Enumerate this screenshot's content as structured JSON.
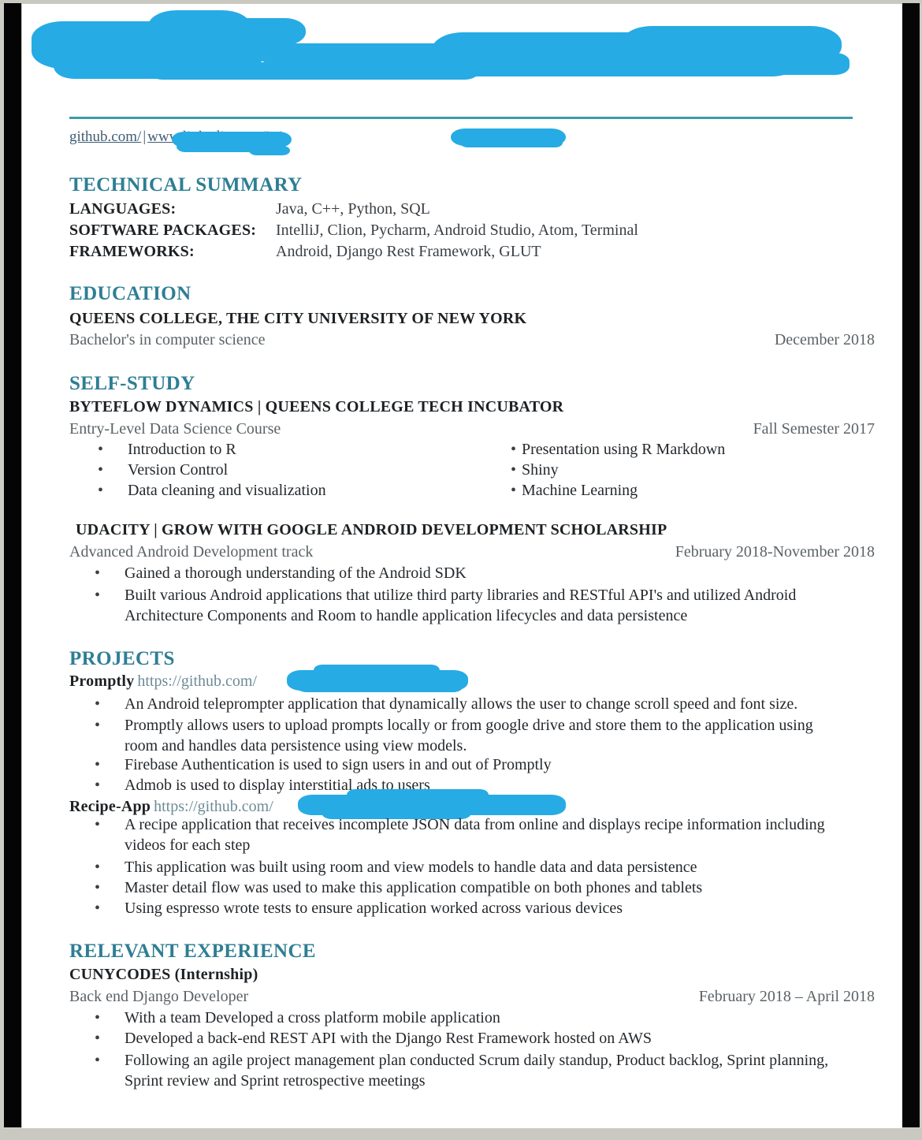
{
  "document": {
    "type": "resume",
    "header": {
      "name_redacted": true,
      "redaction_color": "#26ABE4",
      "contact_line_redacted": true
    },
    "links": {
      "github_prefix": "github.com/",
      "separator": "|",
      "linkedin_prefix": "www.linkedin.com/in/"
    },
    "sections": {
      "technical_summary": {
        "heading": "TECHNICAL SUMMARY",
        "rows": [
          {
            "label": "LANGUAGES:",
            "value": "Java, C++, Python, SQL"
          },
          {
            "label": "SOFTWARE PACKAGES:",
            "value": "IntelliJ, Clion, Pycharm, Android Studio, Atom, Terminal"
          },
          {
            "label": "FRAMEWORKS:",
            "value": "Android, Django Rest Framework, GLUT"
          }
        ]
      },
      "education": {
        "heading": "EDUCATION",
        "school": "QUEENS COLLEGE, THE CITY UNIVERSITY OF NEW YORK",
        "degree": "Bachelor's in computer science",
        "date": "December 2018"
      },
      "self_study": {
        "heading": "SELF-STUDY",
        "entries": [
          {
            "title": "BYTEFLOW DYNAMICS | QUEENS COLLEGE TECH INCUBATOR",
            "subtitle": "Entry-Level Data Science Course",
            "date": "Fall Semester 2017",
            "bullets_left": [
              "Introduction to R",
              "Version Control",
              "Data cleaning and visualization"
            ],
            "bullets_right": [
              "Presentation using R Markdown",
              "Shiny",
              "Machine Learning"
            ]
          },
          {
            "title": "UDACITY | GROW WITH GOOGLE ANDROID DEVELOPMENT SCHOLARSHIP",
            "subtitle": "Advanced Android Development track",
            "date": "February 2018-November 2018",
            "bullets": [
              "Gained a thorough understanding of the Android SDK",
              "Built various Android applications that utilize third party libraries and RESTful API's  and utilized Android Architecture Components and Room to handle application lifecycles and data persistence"
            ]
          }
        ]
      },
      "projects": {
        "heading": "PROJECTS",
        "entries": [
          {
            "name": "Promptly",
            "url": "https://github.com/",
            "url_redacted": true,
            "bullets": [
              "An Android teleprompter application that dynamically allows the user to change scroll speed and font size.",
              "Promptly allows users to upload prompts locally or from google drive and store them to the application using room and handles data persistence using view models.",
              "Firebase Authentication is used to sign users in and out of Promptly",
              "Admob is used to display interstitial ads to users"
            ]
          },
          {
            "name": "Recipe-App",
            "url": "https://github.com/",
            "url_redacted": true,
            "bullets": [
              "A recipe application that receives incomplete JSON data from online and displays recipe information including videos for each step",
              "This application was built using room and view models to handle data and data persistence",
              "Master detail flow was used to make this application compatible on both phones and tablets",
              "Using espresso wrote tests to ensure application worked across various devices"
            ]
          }
        ]
      },
      "relevant_experience": {
        "heading": "RELEVANT EXPERIENCE",
        "entries": [
          {
            "company": "CUNYCODES  (Internship)",
            "role": "Back end Django Developer",
            "date": "February 2018 – April 2018",
            "bullets": [
              "With a team Developed a cross platform mobile application",
              "Developed a back-end REST API with the Django Rest Framework hosted on AWS",
              "Following an agile project management plan conducted Scrum daily standup, Product backlog, Sprint planning, Sprint review and Sprint retrospective meetings"
            ]
          }
        ]
      }
    },
    "bullet_glyph": "•",
    "colors": {
      "section_heading": "#2E7E93",
      "rule": "#3E9AA8",
      "redaction_marker": "#26ABE4",
      "link": "#3F5C73",
      "url_muted": "#6D8B96"
    }
  }
}
